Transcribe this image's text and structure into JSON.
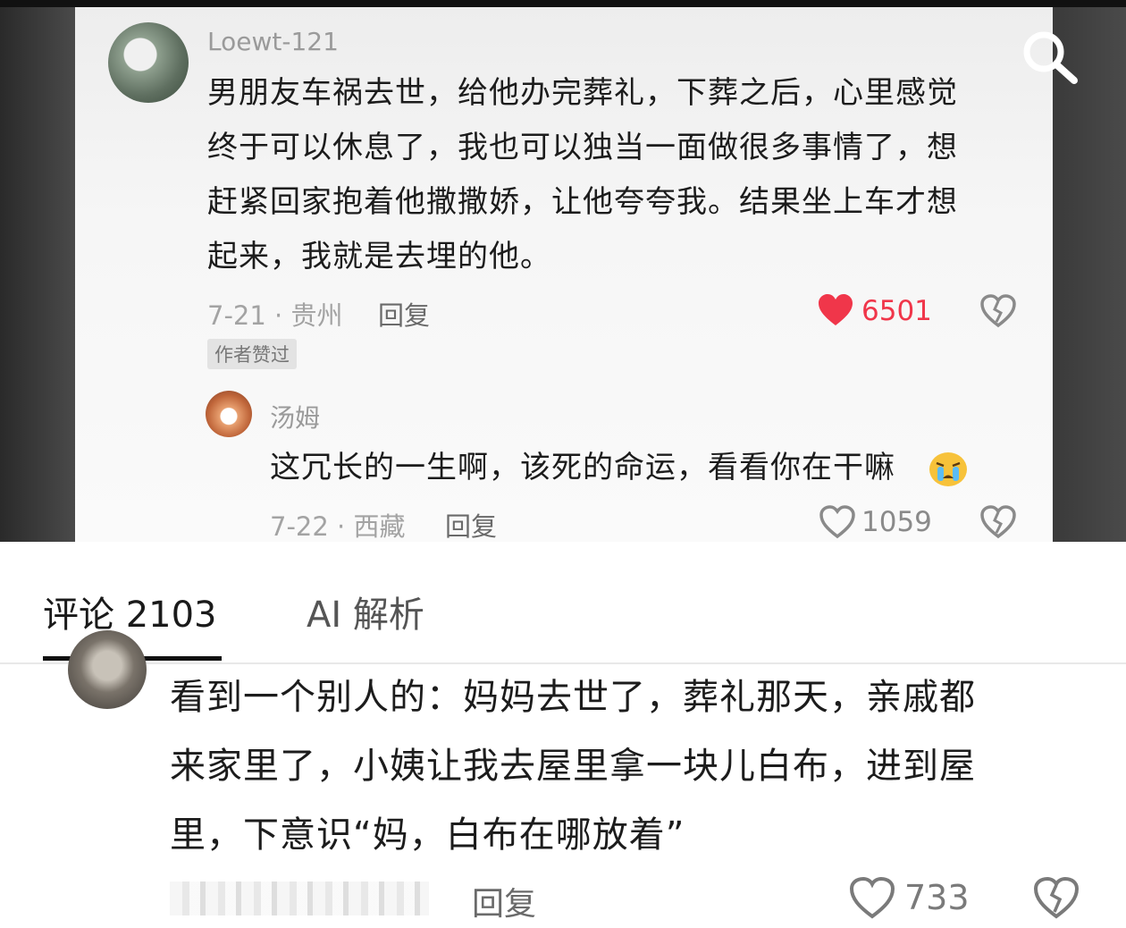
{
  "top_comment": {
    "username": "Loewt-121",
    "text_lines": [
      "男朋友车祸去世，给他办完葬礼，下葬之后，心里感觉",
      "终于可以休息了，我也可以独当一面做很多事情了，想",
      "赶紧回家抱着他撒撒娇，让他夸夸我。结果坐上车才想",
      "起来，我就是去埋的他。"
    ],
    "date_location": "7-21 · 贵州",
    "reply_label": "回复",
    "likes": "6501",
    "badge": "作者赞过"
  },
  "sub_reply": {
    "username": "汤姆",
    "text": "这冗长的一生啊，该死的命运，看看你在干嘛",
    "emoji": "crying-face-icon",
    "date_location": "7-22 · 西藏",
    "reply_label": "回复",
    "likes": "1059"
  },
  "tabs": {
    "comments": "评论 2103",
    "ai": "AI 解析"
  },
  "bottom_comment": {
    "text_lines": [
      "看到一个别人的：妈妈去世了，葬礼那天，亲戚都",
      "来家里了，小姨让我去屋里拿一块儿白布，进到屋",
      "里，下意识“妈，白布在哪放着”"
    ],
    "reply_label": "回复",
    "likes": "733"
  },
  "colors": {
    "liked_red": "#f0364a",
    "muted_gray": "#a3a3a3"
  }
}
